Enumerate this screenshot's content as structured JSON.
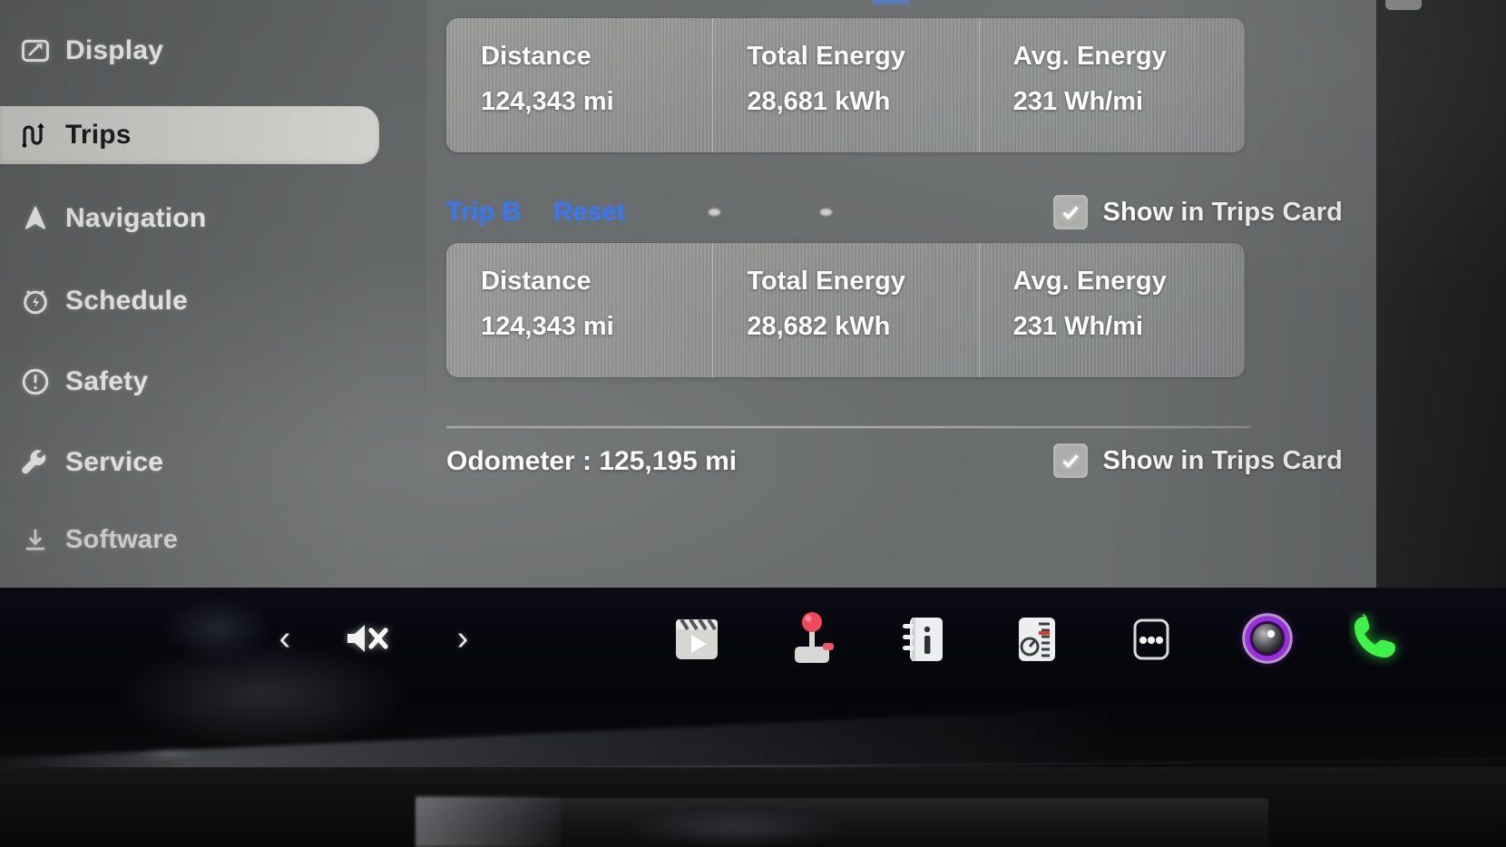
{
  "app": {
    "screen_title": "Trips"
  },
  "sidebar": {
    "items": [
      {
        "label": "Display",
        "icon": "display-icon",
        "active": false
      },
      {
        "label": "Trips",
        "icon": "trips-icon",
        "active": true
      },
      {
        "label": "Navigation",
        "icon": "navigation-icon",
        "active": false
      },
      {
        "label": "Schedule",
        "icon": "schedule-icon",
        "active": false
      },
      {
        "label": "Safety",
        "icon": "safety-icon",
        "active": false
      },
      {
        "label": "Service",
        "icon": "service-icon",
        "active": false
      },
      {
        "label": "Software",
        "icon": "software-icon",
        "active": false
      }
    ]
  },
  "main": {
    "trip_a_card": {
      "metrics": [
        {
          "key": "Distance",
          "value": "124,343 mi"
        },
        {
          "key": "Total Energy",
          "value": "28,681 kWh"
        },
        {
          "key": "Avg. Energy",
          "value": "231 Wh/mi"
        }
      ]
    },
    "trip_b_row": {
      "name_label": "Trip B",
      "reset_label": "Reset",
      "checkbox_label": "Show in Trips Card",
      "checkbox_checked": true
    },
    "trip_b_card": {
      "metrics": [
        {
          "key": "Distance",
          "value": "124,343 mi"
        },
        {
          "key": "Total Energy",
          "value": "28,682 kWh"
        },
        {
          "key": "Avg. Energy",
          "value": "231 Wh/mi"
        }
      ]
    },
    "odometer_row": {
      "text": "Odometer : 125,195 mi",
      "checkbox_label": "Show in Trips Card",
      "checkbox_checked": true
    }
  },
  "launcher_bar": {
    "items": [
      {
        "name": "previous-track-button",
        "icon": "chevron-left-icon",
        "glyph": "‹"
      },
      {
        "name": "mute-button",
        "icon": "mute-icon",
        "glyph": ""
      },
      {
        "name": "next-track-button",
        "icon": "chevron-right-icon",
        "glyph": "›"
      },
      {
        "name": "theater-button",
        "icon": "clapperboard-play-icon",
        "glyph": ""
      },
      {
        "name": "arcade-button",
        "icon": "joystick-icon",
        "glyph": ""
      },
      {
        "name": "info-button",
        "icon": "info-notebook-icon",
        "glyph": ""
      },
      {
        "name": "energy-button",
        "icon": "gauge-meter-icon",
        "glyph": ""
      },
      {
        "name": "more-apps-button",
        "icon": "ellipsis-icon",
        "glyph": ""
      },
      {
        "name": "dashcam-button",
        "icon": "camera-ring-icon",
        "glyph": ""
      },
      {
        "name": "phone-button",
        "icon": "phone-handset-icon",
        "glyph": ""
      }
    ]
  },
  "colors": {
    "panel_bg": "#6a6d6d",
    "sidebar_bg": "#646767",
    "card_bg": "#8d908e",
    "active_item_bg": "#d2d2ce",
    "link_blue": "#3c79e8",
    "phone_green": "#3ff24a",
    "dashcam_purple": "#9b2fe0",
    "joystick_red": "#f2485c",
    "text_primary": "#ffffff"
  }
}
